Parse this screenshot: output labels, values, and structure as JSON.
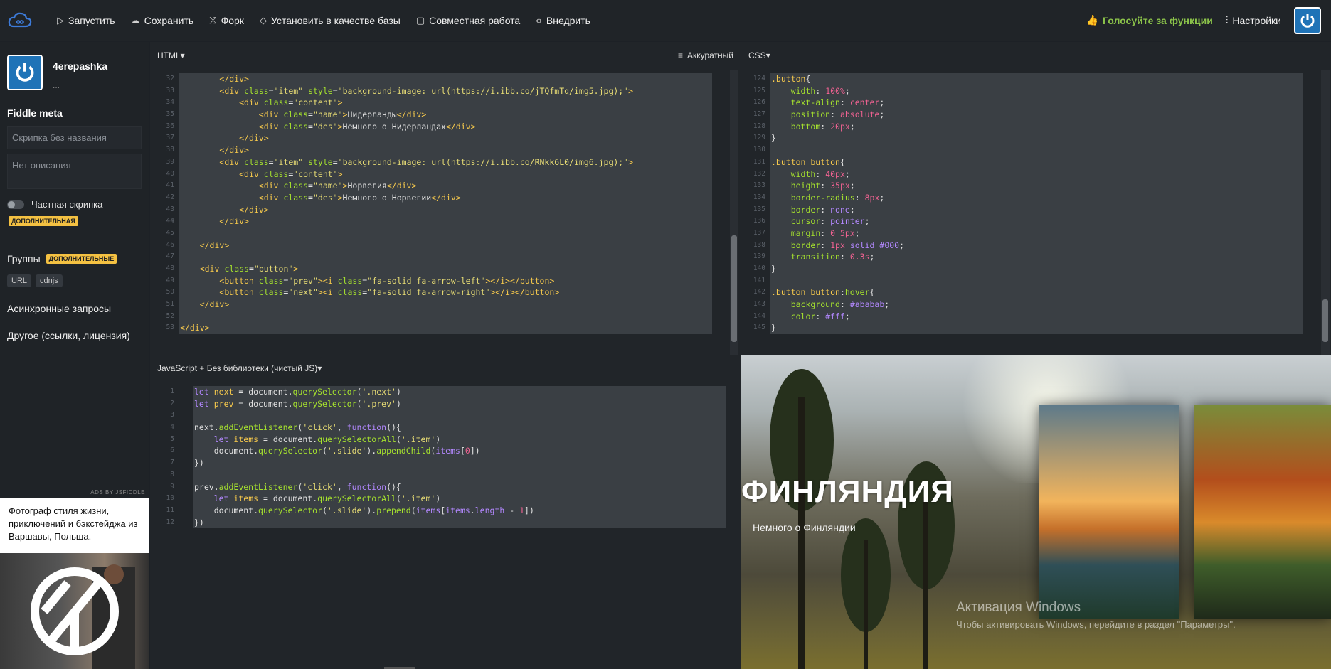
{
  "topbar": {
    "run": "Запустить",
    "save": "Сохранить",
    "fork": "Форк",
    "set_base": "Установить в качестве базы",
    "collab": "Совместная работа",
    "embed": "Внедрить",
    "vote": "Голосуйте за функции",
    "settings": "Настройки"
  },
  "sidebar": {
    "username": "4erepashka",
    "user_sub": "...",
    "meta_title": "Fiddle meta",
    "name_placeholder": "Скрипка без названия",
    "desc_placeholder": "Нет описания",
    "private_label": "Частная скрипка",
    "private_badge": "ДОПОЛНИТЕЛЬНАЯ",
    "groups_label": "Группы",
    "groups_badge": "ДОПОЛНИТЕЛЬНЫЕ",
    "chips": [
      "URL",
      "cdnjs"
    ],
    "async": "Асинхронные запросы",
    "other": "Другое (ссылки, лицензия)",
    "ads_label": "ADS BY JSFIDDLE",
    "ad_text": "Фотограф стиля жизни, приключений и бэкстейджа из Варшавы, Польша."
  },
  "html_panel": {
    "title": "HTML",
    "tidy": "Аккуратный",
    "line_numbers": [
      "32",
      "33",
      "34",
      "35",
      "36",
      "37",
      "38",
      "39",
      "40",
      "41",
      "42",
      "43",
      "44",
      "45",
      "46",
      "47",
      "48",
      "49",
      "50",
      "51",
      "52",
      "53"
    ]
  },
  "css_panel": {
    "title": "CSS",
    "line_numbers": [
      "124",
      "125",
      "126",
      "127",
      "128",
      "129",
      "130",
      "131",
      "132",
      "133",
      "134",
      "135",
      "136",
      "137",
      "138",
      "139",
      "140",
      "141",
      "142",
      "143",
      "144",
      "145"
    ]
  },
  "js_panel": {
    "title": "JavaScript + Без библиотеки (чистый JS)",
    "line_numbers": [
      "1",
      "2",
      "3",
      "4",
      "5",
      "6",
      "7",
      "8",
      "9",
      "10",
      "11",
      "12"
    ]
  },
  "preview": {
    "country": "ФИНЛЯНДИЯ",
    "country_desc": "Немного о Финляндии",
    "win_title": "Активация Windows",
    "win_sub": "Чтобы активировать Windows, перейдите в раздел \"Параметры\"."
  }
}
